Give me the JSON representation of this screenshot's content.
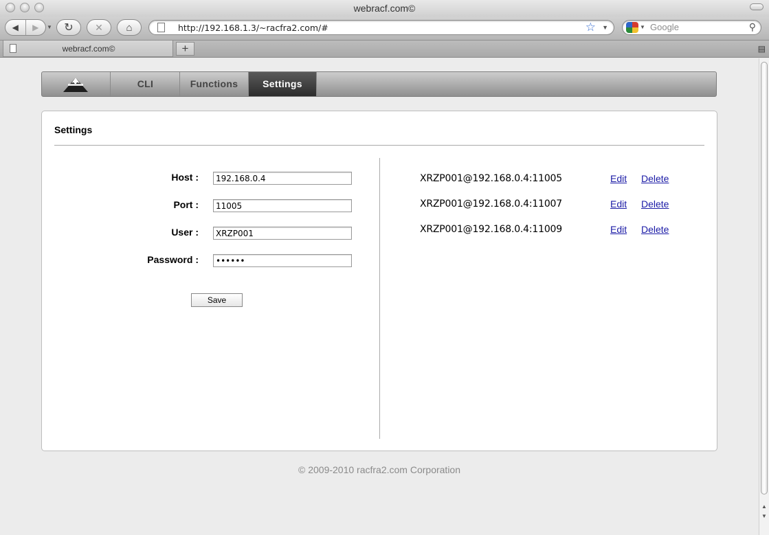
{
  "window": {
    "title": "webracf.com©"
  },
  "toolbar": {
    "back_icon": "back-arrow-icon",
    "forward_icon": "forward-arrow-icon",
    "url": "http://192.168.1.3/~racfra2.com/#",
    "search_placeholder": "Google"
  },
  "tabs": {
    "active_label": "webracf.com©",
    "new_tab_label": "+"
  },
  "nav": {
    "logo_icon": "mountain-logo-icon",
    "items": [
      {
        "label": "CLI",
        "active": false
      },
      {
        "label": "Functions",
        "active": false
      },
      {
        "label": "Settings",
        "active": true
      }
    ]
  },
  "settings": {
    "title": "Settings",
    "form": {
      "host_label": "Host :",
      "host_value": "192.168.0.4",
      "port_label": "Port :",
      "port_value": "11005",
      "user_label": "User :",
      "user_value": "XRZP001",
      "password_label": "Password :",
      "password_value": "••••••",
      "save_label": "Save"
    },
    "connections": [
      {
        "name": "XRZP001@192.168.0.4:11005",
        "edit": "Edit",
        "delete": "Delete"
      },
      {
        "name": "XRZP001@192.168.0.4:11007",
        "edit": "Edit",
        "delete": "Delete"
      },
      {
        "name": "XRZP001@192.168.0.4:11009",
        "edit": "Edit",
        "delete": "Delete"
      }
    ]
  },
  "footer": {
    "text": "© 2009-2010 racfra2.com Corporation"
  },
  "colors": {
    "link": "#1a1aa6",
    "active_tab": "#3a3a3a",
    "footer_text": "#8a8a8a"
  }
}
